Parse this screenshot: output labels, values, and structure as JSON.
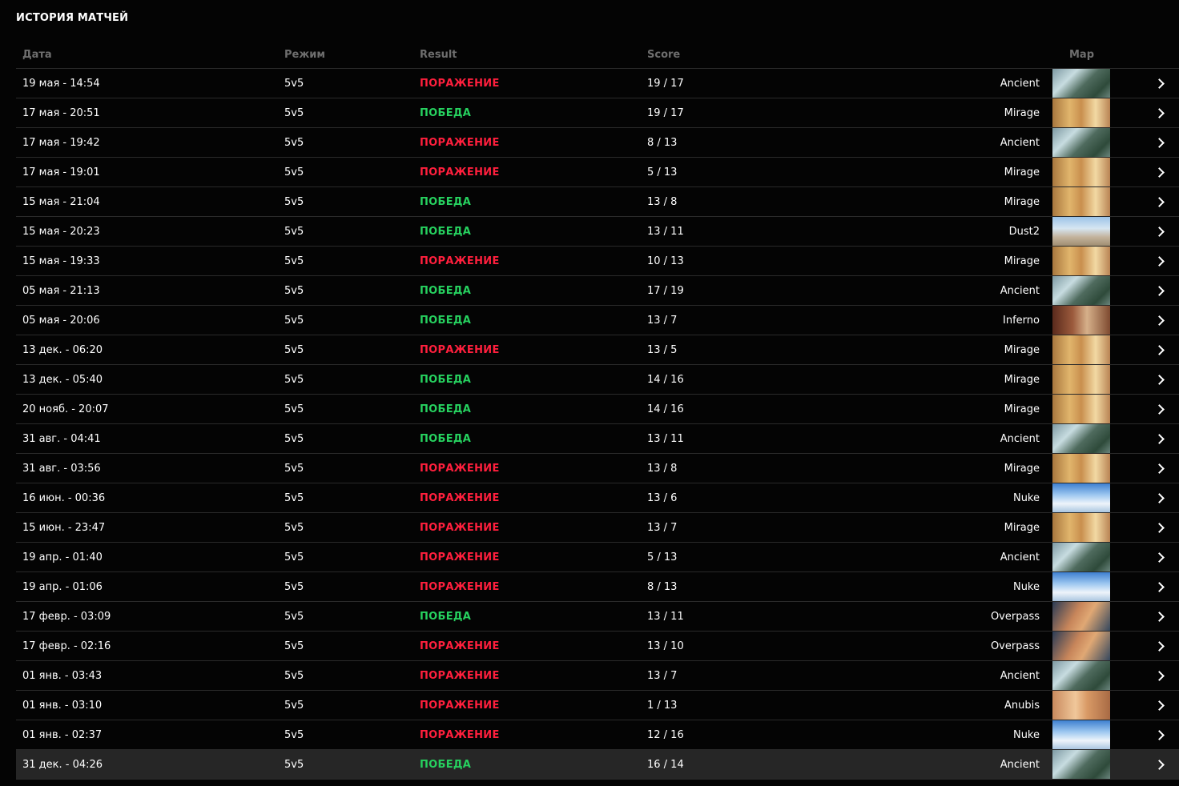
{
  "page": {
    "title": "ИСТОРИЯ МАТЧЕЙ"
  },
  "columns": {
    "date": "Дата",
    "mode": "Режим",
    "result": "Result",
    "score": "Score",
    "map": "Map"
  },
  "colors": {
    "loss": "#ff1f3d",
    "win": "#26d15f",
    "background": "#040404",
    "highlight_row": "#262626"
  },
  "matches": [
    {
      "date": "19 мая - 14:54",
      "mode": "5v5",
      "result": "ПОРАЖЕНИЕ",
      "outcome": "loss",
      "score": "19 / 17",
      "map": "Ancient",
      "thumb": "ancient"
    },
    {
      "date": "17 мая - 20:51",
      "mode": "5v5",
      "result": "ПОБЕДА",
      "outcome": "win",
      "score": "19 / 17",
      "map": "Mirage",
      "thumb": "mirage"
    },
    {
      "date": "17 мая - 19:42",
      "mode": "5v5",
      "result": "ПОРАЖЕНИЕ",
      "outcome": "loss",
      "score": "8 / 13",
      "map": "Ancient",
      "thumb": "ancient"
    },
    {
      "date": "17 мая - 19:01",
      "mode": "5v5",
      "result": "ПОРАЖЕНИЕ",
      "outcome": "loss",
      "score": "5 / 13",
      "map": "Mirage",
      "thumb": "mirage"
    },
    {
      "date": "15 мая - 21:04",
      "mode": "5v5",
      "result": "ПОБЕДА",
      "outcome": "win",
      "score": "13 / 8",
      "map": "Mirage",
      "thumb": "mirage"
    },
    {
      "date": "15 мая - 20:23",
      "mode": "5v5",
      "result": "ПОБЕДА",
      "outcome": "win",
      "score": "13 / 11",
      "map": "Dust2",
      "thumb": "dust2"
    },
    {
      "date": "15 мая - 19:33",
      "mode": "5v5",
      "result": "ПОРАЖЕНИЕ",
      "outcome": "loss",
      "score": "10 / 13",
      "map": "Mirage",
      "thumb": "mirage"
    },
    {
      "date": "05 мая - 21:13",
      "mode": "5v5",
      "result": "ПОБЕДА",
      "outcome": "win",
      "score": "17 / 19",
      "map": "Ancient",
      "thumb": "ancient"
    },
    {
      "date": "05 мая - 20:06",
      "mode": "5v5",
      "result": "ПОБЕДА",
      "outcome": "win",
      "score": "13 / 7",
      "map": "Inferno",
      "thumb": "inferno"
    },
    {
      "date": "13 дек. - 06:20",
      "mode": "5v5",
      "result": "ПОРАЖЕНИЕ",
      "outcome": "loss",
      "score": "13 / 5",
      "map": "Mirage",
      "thumb": "mirage"
    },
    {
      "date": "13 дек. - 05:40",
      "mode": "5v5",
      "result": "ПОБЕДА",
      "outcome": "win",
      "score": "14 / 16",
      "map": "Mirage",
      "thumb": "mirage"
    },
    {
      "date": "20 нояб. - 20:07",
      "mode": "5v5",
      "result": "ПОБЕДА",
      "outcome": "win",
      "score": "14 / 16",
      "map": "Mirage",
      "thumb": "mirage"
    },
    {
      "date": "31 авг. - 04:41",
      "mode": "5v5",
      "result": "ПОБЕДА",
      "outcome": "win",
      "score": "13 / 11",
      "map": "Ancient",
      "thumb": "ancient"
    },
    {
      "date": "31 авг. - 03:56",
      "mode": "5v5",
      "result": "ПОРАЖЕНИЕ",
      "outcome": "loss",
      "score": "13 / 8",
      "map": "Mirage",
      "thumb": "mirage"
    },
    {
      "date": "16 июн. - 00:36",
      "mode": "5v5",
      "result": "ПОРАЖЕНИЕ",
      "outcome": "loss",
      "score": "13 / 6",
      "map": "Nuke",
      "thumb": "nuke"
    },
    {
      "date": "15 июн. - 23:47",
      "mode": "5v5",
      "result": "ПОРАЖЕНИЕ",
      "outcome": "loss",
      "score": "13 / 7",
      "map": "Mirage",
      "thumb": "mirage"
    },
    {
      "date": "19 апр. - 01:40",
      "mode": "5v5",
      "result": "ПОРАЖЕНИЕ",
      "outcome": "loss",
      "score": "5 / 13",
      "map": "Ancient",
      "thumb": "ancient"
    },
    {
      "date": "19 апр. - 01:06",
      "mode": "5v5",
      "result": "ПОРАЖЕНИЕ",
      "outcome": "loss",
      "score": "8 / 13",
      "map": "Nuke",
      "thumb": "nuke"
    },
    {
      "date": "17 февр. - 03:09",
      "mode": "5v5",
      "result": "ПОБЕДА",
      "outcome": "win",
      "score": "13 / 11",
      "map": "Overpass",
      "thumb": "overpass"
    },
    {
      "date": "17 февр. - 02:16",
      "mode": "5v5",
      "result": "ПОРАЖЕНИЕ",
      "outcome": "loss",
      "score": "13 / 10",
      "map": "Overpass",
      "thumb": "overpass"
    },
    {
      "date": "01 янв. - 03:43",
      "mode": "5v5",
      "result": "ПОРАЖЕНИЕ",
      "outcome": "loss",
      "score": "13 / 7",
      "map": "Ancient",
      "thumb": "ancient"
    },
    {
      "date": "01 янв. - 03:10",
      "mode": "5v5",
      "result": "ПОРАЖЕНИЕ",
      "outcome": "loss",
      "score": "1 / 13",
      "map": "Anubis",
      "thumb": "anubis"
    },
    {
      "date": "01 янв. - 02:37",
      "mode": "5v5",
      "result": "ПОРАЖЕНИЕ",
      "outcome": "loss",
      "score": "12 / 16",
      "map": "Nuke",
      "thumb": "nuke"
    },
    {
      "date": "31 дек. - 04:26",
      "mode": "5v5",
      "result": "ПОБЕДА",
      "outcome": "win",
      "score": "16 / 14",
      "map": "Ancient",
      "thumb": "ancient",
      "highlighted": true
    }
  ]
}
